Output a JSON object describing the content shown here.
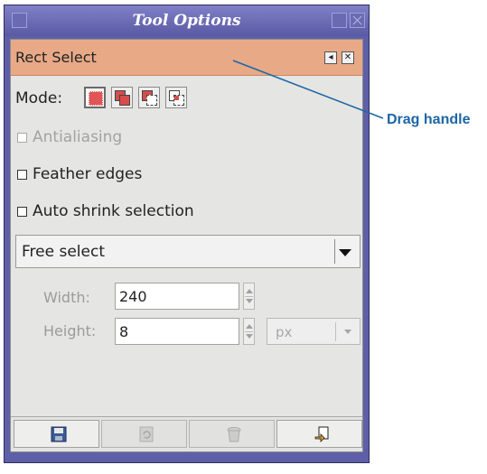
{
  "window": {
    "title": "Tool Options"
  },
  "panel": {
    "title": "Rect Select"
  },
  "mode": {
    "label": "Mode:",
    "buttons": [
      "replace",
      "add",
      "subtract",
      "intersect"
    ],
    "active": 0
  },
  "options": {
    "antialiasing": "Antialiasing",
    "feather_edges": "Feather edges",
    "auto_shrink": "Auto shrink selection"
  },
  "select_mode": {
    "value": "Free select"
  },
  "size": {
    "width_label": "Width:",
    "width_value": "240",
    "height_label": "Height:",
    "height_value": "8",
    "unit": "px"
  },
  "bottom_buttons": [
    "save-icon",
    "restore-icon",
    "delete-icon",
    "reset-icon"
  ],
  "annotation": {
    "label": "Drag handle"
  },
  "colors": {
    "title_bar": "#5f5fa8",
    "panel_header": "#e8a987",
    "callout": "#1c66a6",
    "mode_fill": "#e05555"
  }
}
